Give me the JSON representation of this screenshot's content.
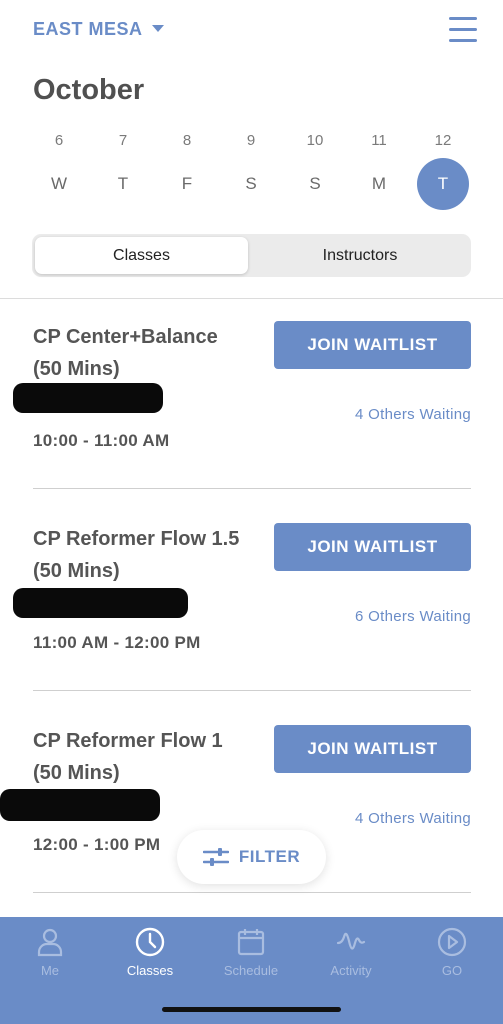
{
  "header": {
    "location": "EAST MESA",
    "month": "October"
  },
  "week": [
    {
      "num": "6",
      "letter": "W",
      "selected": false
    },
    {
      "num": "7",
      "letter": "T",
      "selected": false
    },
    {
      "num": "8",
      "letter": "F",
      "selected": false
    },
    {
      "num": "9",
      "letter": "S",
      "selected": false
    },
    {
      "num": "10",
      "letter": "S",
      "selected": false
    },
    {
      "num": "11",
      "letter": "M",
      "selected": false
    },
    {
      "num": "12",
      "letter": "T",
      "selected": true
    }
  ],
  "segments": {
    "classes": "Classes",
    "instructors": "Instructors",
    "active": "classes"
  },
  "classes": [
    {
      "title_line1": "CP Center+Balance",
      "title_line2": "(50 Mins)",
      "time": "10:00 - 11:00 AM",
      "button": "JOIN WAITLIST",
      "waiting": "4 Others Waiting"
    },
    {
      "title_line1": "CP Reformer Flow 1.5",
      "title_line2": "(50 Mins)",
      "time": "11:00 AM - 12:00 PM",
      "button": "JOIN WAITLIST",
      "waiting": "6 Others Waiting"
    },
    {
      "title_line1": "CP Reformer Flow 1",
      "title_line2": "(50 Mins)",
      "time": "12:00 - 1:00 PM",
      "button": "JOIN WAITLIST",
      "waiting": "4 Others Waiting"
    }
  ],
  "filter": {
    "label": "FILTER",
    "icon": "sliders-icon"
  },
  "tabbar": [
    {
      "label": "Me",
      "icon": "person-icon",
      "active": false
    },
    {
      "label": "Classes",
      "icon": "clock-icon",
      "active": true
    },
    {
      "label": "Schedule",
      "icon": "calendar-icon",
      "active": false
    },
    {
      "label": "Activity",
      "icon": "activity-wave-icon",
      "active": false
    },
    {
      "label": "GO",
      "icon": "play-circle-icon",
      "active": false
    }
  ],
  "colors": {
    "accent": "#6a8cc7",
    "text": "#505050",
    "tab_inactive": "#a9bde0"
  }
}
